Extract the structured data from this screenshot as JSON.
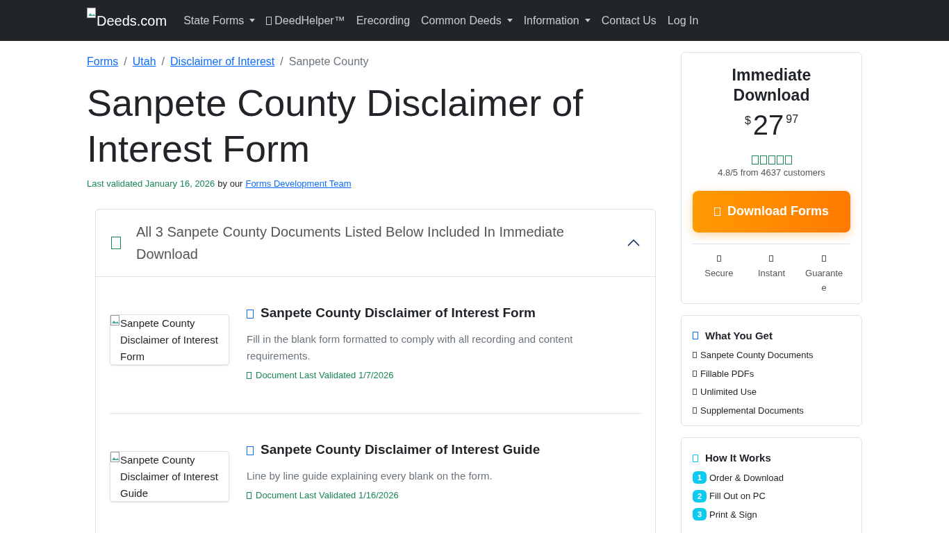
{
  "navbar": {
    "brand": "Deeds.com",
    "items": [
      {
        "label": "State Forms",
        "dropdown": true,
        "icon": false
      },
      {
        "label": "DeedHelper™",
        "dropdown": false,
        "icon": true
      },
      {
        "label": "Erecording",
        "dropdown": false,
        "icon": false
      },
      {
        "label": "Common Deeds",
        "dropdown": true,
        "icon": false
      },
      {
        "label": "Information",
        "dropdown": true,
        "icon": false
      },
      {
        "label": "Contact Us",
        "dropdown": false,
        "icon": false
      },
      {
        "label": "Log In",
        "dropdown": false,
        "icon": false
      }
    ]
  },
  "breadcrumb": [
    {
      "label": "Forms",
      "link": true
    },
    {
      "separator": "/",
      "label": "Utah",
      "link": true
    },
    {
      "separator": "/",
      "label": "Disclaimer of Interest",
      "link": true
    },
    {
      "separator": "/",
      "label": "Sanpete County",
      "link": false
    }
  ],
  "title": "Sanpete County Disclaimer of Interest Form",
  "validated": {
    "date": "Last validated January 16, 2026",
    "by": "by our",
    "team": "Forms Development Team"
  },
  "accordion": {
    "header": "All 3 Sanpete County Documents Listed Below Included In Immediate Download",
    "expanded": true,
    "documents": [
      {
        "image_alt": "Sanpete County Disclaimer of Interest Form",
        "title": "Sanpete County Disclaimer of Interest Form",
        "description": "Fill in the blank form formatted to comply with all recording and content requirements.",
        "validated": "Document Last Validated 1/7/2026"
      },
      {
        "image_alt": "Sanpete County Disclaimer of Interest Guide",
        "title": "Sanpete County Disclaimer of Interest Guide",
        "description": "Line by line guide explaining every blank on the form.",
        "validated": "Document Last Validated 1/16/2026"
      }
    ]
  },
  "purchase": {
    "heading": "Immediate Download",
    "currency": "$",
    "dollars": "27",
    "cents": "97",
    "rating": "4.8/5 from 4637 customers",
    "button": "Download Forms",
    "features": [
      "Secure",
      "Instant",
      "Guarantee"
    ]
  },
  "what_you_get": {
    "heading": "What You Get",
    "items": [
      "Sanpete County Documents",
      "Fillable PDFs",
      "Unlimited Use",
      "Supplemental Documents"
    ]
  },
  "how_it_works": {
    "heading": "How It Works",
    "steps": [
      {
        "number": "1",
        "label": "Order & Download"
      },
      {
        "number": "2",
        "label": "Fill Out on PC"
      },
      {
        "number": "3",
        "label": "Print & Sign"
      }
    ]
  }
}
